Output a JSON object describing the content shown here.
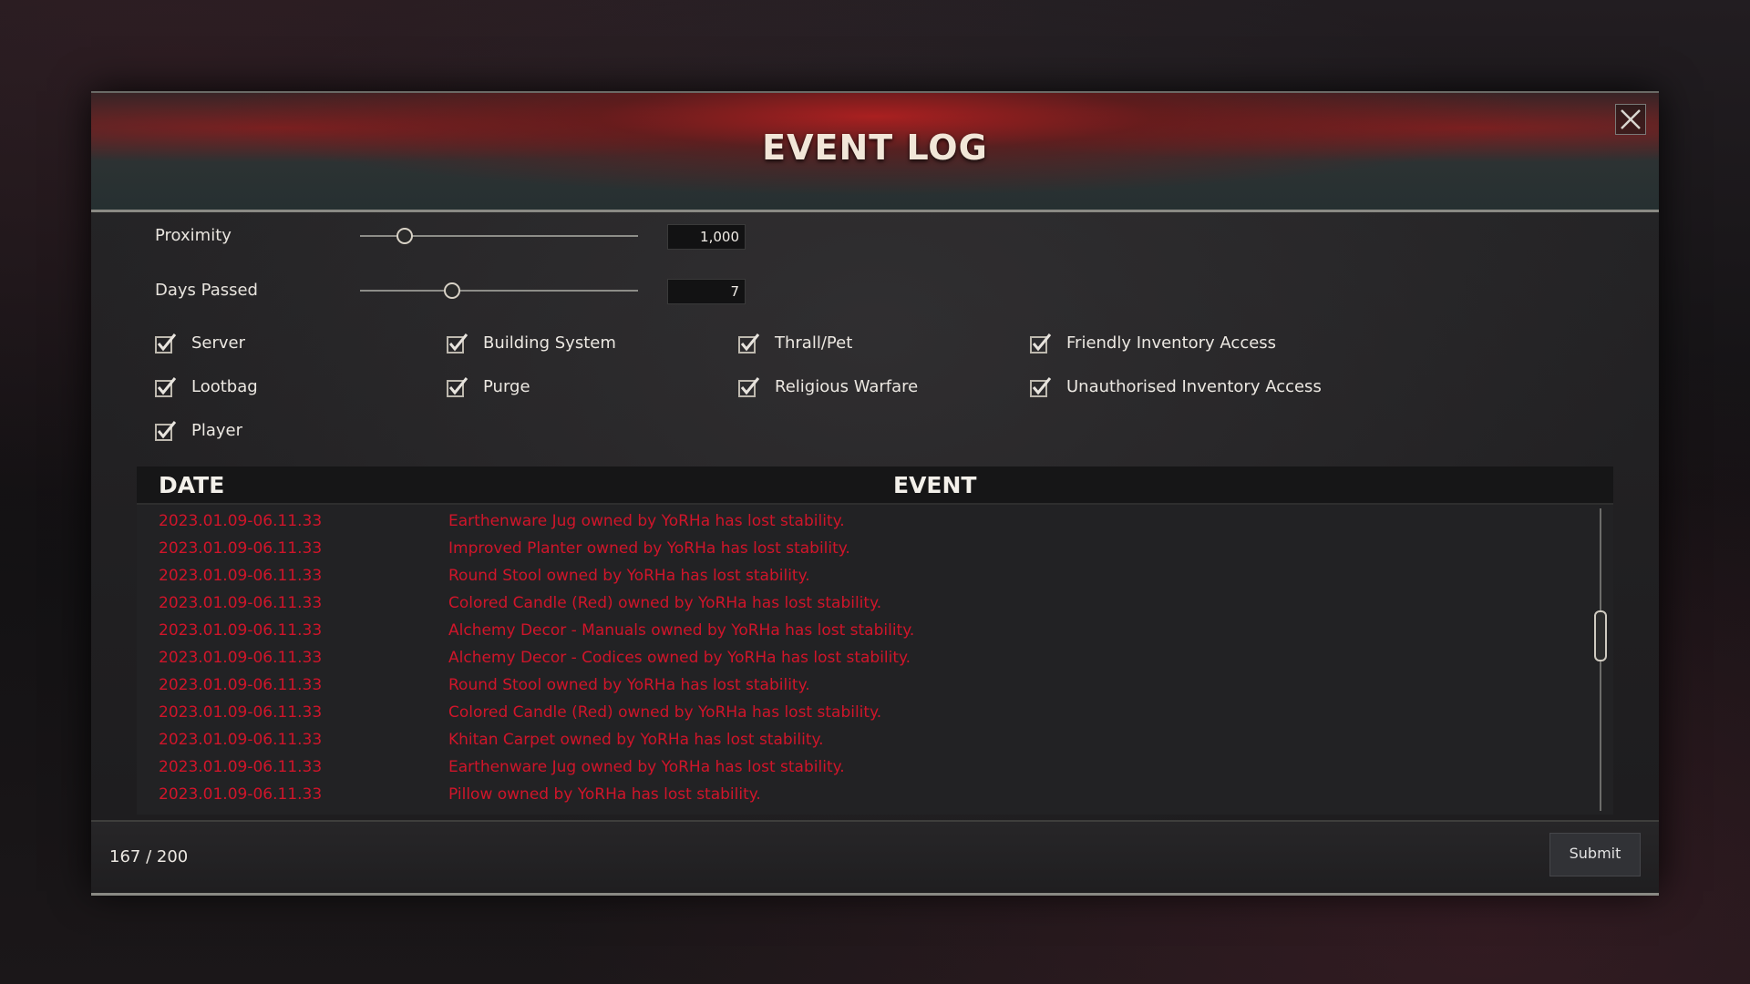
{
  "window": {
    "title": "EVENT LOG",
    "close_icon": "close-icon"
  },
  "filters": {
    "proximity": {
      "label": "Proximity",
      "value": "1,000",
      "fraction": 0.16
    },
    "days_passed": {
      "label": "Days Passed",
      "value": "7",
      "fraction": 0.33
    },
    "categories": [
      {
        "label": "Server",
        "checked": true
      },
      {
        "label": "Building System",
        "checked": true
      },
      {
        "label": "Thrall/Pet",
        "checked": true
      },
      {
        "label": "Friendly Inventory Access",
        "checked": true
      },
      {
        "label": "Lootbag",
        "checked": true
      },
      {
        "label": "Purge",
        "checked": true
      },
      {
        "label": "Religious Warfare",
        "checked": true
      },
      {
        "label": "Unauthorised Inventory Access",
        "checked": true
      },
      {
        "label": "Player",
        "checked": true
      }
    ]
  },
  "table": {
    "headers": {
      "date": "DATE",
      "event": "EVENT"
    },
    "rows": [
      {
        "date": "2023.01.09-06.11.33",
        "event": "Earthenware Jug owned by YoRHa has lost stability."
      },
      {
        "date": "2023.01.09-06.11.33",
        "event": "Improved Planter owned by YoRHa has lost stability."
      },
      {
        "date": "2023.01.09-06.11.33",
        "event": "Round Stool owned by YoRHa has lost stability."
      },
      {
        "date": "2023.01.09-06.11.33",
        "event": "Colored Candle (Red) owned by YoRHa has lost stability."
      },
      {
        "date": "2023.01.09-06.11.33",
        "event": "Alchemy Decor - Manuals owned by YoRHa has lost stability."
      },
      {
        "date": "2023.01.09-06.11.33",
        "event": "Alchemy Decor - Codices owned by YoRHa has lost stability."
      },
      {
        "date": "2023.01.09-06.11.33",
        "event": "Round Stool owned by YoRHa has lost stability."
      },
      {
        "date": "2023.01.09-06.11.33",
        "event": "Colored Candle (Red) owned by YoRHa has lost stability."
      },
      {
        "date": "2023.01.09-06.11.33",
        "event": "Khitan Carpet owned by YoRHa has lost stability."
      },
      {
        "date": "2023.01.09-06.11.33",
        "event": "Earthenware Jug owned by YoRHa has lost stability."
      },
      {
        "date": "2023.01.09-06.11.33",
        "event": "Pillow owned by YoRHa has lost stability."
      }
    ],
    "event_color": "#d0152a"
  },
  "footer": {
    "counter": "167 / 200",
    "submit_label": "Submit"
  },
  "colors": {
    "accent_red": "#c41e24",
    "text": "#e8e4de"
  }
}
